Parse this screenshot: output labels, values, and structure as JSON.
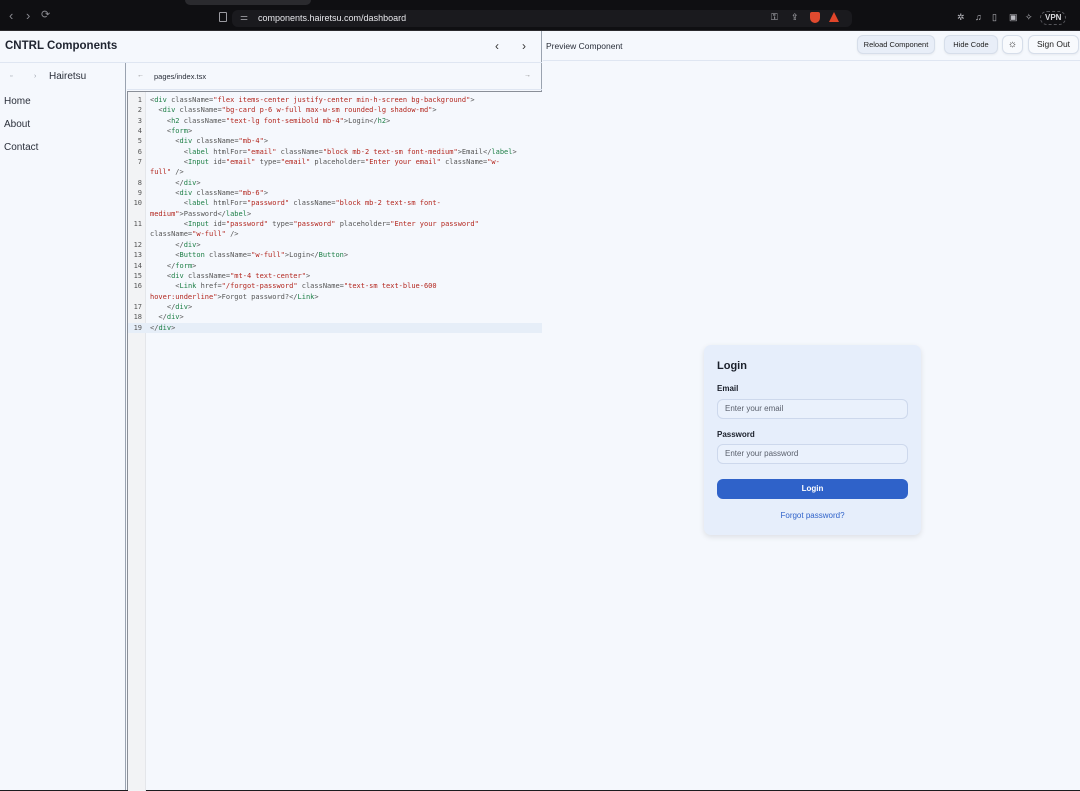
{
  "browser": {
    "url": "components.hairetsu.com/dashboard",
    "vpn_label": "VPN",
    "nav": {
      "back": "‹",
      "forward": "›",
      "reload": "⟳"
    }
  },
  "app": {
    "title": "CNTRL Components",
    "header_prev": "‹",
    "header_next": "›"
  },
  "sidebar": {
    "brand": "Hairetsu",
    "items": [
      {
        "label": "Home"
      },
      {
        "label": "About"
      },
      {
        "label": "Contact"
      }
    ]
  },
  "editor": {
    "file_name": "pages/index.tsx",
    "lines": [
      {
        "n": "1",
        "segs": [
          [
            "pu",
            "<"
          ],
          [
            "tg",
            "div"
          ],
          [
            "pu",
            " className="
          ],
          [
            "st",
            "\"flex items-center justify-center min-h-screen bg-background\""
          ],
          [
            "pu",
            ">"
          ]
        ]
      },
      {
        "n": "2",
        "segs": [
          [
            "pu",
            "  <"
          ],
          [
            "tg",
            "div"
          ],
          [
            "pu",
            " className="
          ],
          [
            "st",
            "\"bg-card p-6 w-full max-w-sm rounded-lg shadow-md\""
          ],
          [
            "pu",
            ">"
          ]
        ]
      },
      {
        "n": "3",
        "segs": [
          [
            "pu",
            "    <"
          ],
          [
            "tg",
            "h2"
          ],
          [
            "pu",
            " className="
          ],
          [
            "st",
            "\"text-lg font-semibold mb-4\""
          ],
          [
            "pu",
            ">Login</"
          ],
          [
            "tg",
            "h2"
          ],
          [
            "pu",
            ">"
          ]
        ]
      },
      {
        "n": "4",
        "segs": [
          [
            "pu",
            "    <"
          ],
          [
            "tg",
            "form"
          ],
          [
            "pu",
            ">"
          ]
        ]
      },
      {
        "n": "5",
        "segs": [
          [
            "pu",
            "      <"
          ],
          [
            "tg",
            "div"
          ],
          [
            "pu",
            " className="
          ],
          [
            "st",
            "\"mb-4\""
          ],
          [
            "pu",
            ">"
          ]
        ]
      },
      {
        "n": "6",
        "segs": [
          [
            "pu",
            "        <"
          ],
          [
            "tg",
            "label"
          ],
          [
            "pu",
            " htmlFor="
          ],
          [
            "st",
            "\"email\""
          ],
          [
            "pu",
            " className="
          ],
          [
            "st",
            "\"block mb-2 text-sm font-medium\""
          ],
          [
            "pu",
            ">Email</"
          ],
          [
            "tg",
            "label"
          ],
          [
            "pu",
            ">"
          ]
        ]
      },
      {
        "n": "7",
        "segs": [
          [
            "pu",
            "        <"
          ],
          [
            "tg",
            "Input"
          ],
          [
            "pu",
            " id="
          ],
          [
            "st",
            "\"email\""
          ],
          [
            "pu",
            " type="
          ],
          [
            "st",
            "\"email\""
          ],
          [
            "pu",
            " placeholder="
          ],
          [
            "st",
            "\"Enter your email\""
          ],
          [
            "pu",
            " className="
          ],
          [
            "st",
            "\"w-"
          ]
        ]
      },
      {
        "n": "",
        "segs": [
          [
            "st",
            "full\""
          ],
          [
            "pu",
            " />"
          ]
        ]
      },
      {
        "n": "8",
        "segs": [
          [
            "pu",
            "      </"
          ],
          [
            "tg",
            "div"
          ],
          [
            "pu",
            ">"
          ]
        ]
      },
      {
        "n": "9",
        "segs": [
          [
            "pu",
            "      <"
          ],
          [
            "tg",
            "div"
          ],
          [
            "pu",
            " className="
          ],
          [
            "st",
            "\"mb-6\""
          ],
          [
            "pu",
            ">"
          ]
        ]
      },
      {
        "n": "10",
        "segs": [
          [
            "pu",
            "        <"
          ],
          [
            "tg",
            "label"
          ],
          [
            "pu",
            " htmlFor="
          ],
          [
            "st",
            "\"password\""
          ],
          [
            "pu",
            " className="
          ],
          [
            "st",
            "\"block mb-2 text-sm font-"
          ]
        ]
      },
      {
        "n": "",
        "segs": [
          [
            "st",
            "medium\""
          ],
          [
            "pu",
            ">Password</"
          ],
          [
            "tg",
            "label"
          ],
          [
            "pu",
            ">"
          ]
        ]
      },
      {
        "n": "11",
        "segs": [
          [
            "pu",
            "        <"
          ],
          [
            "tg",
            "Input"
          ],
          [
            "pu",
            " id="
          ],
          [
            "st",
            "\"password\""
          ],
          [
            "pu",
            " type="
          ],
          [
            "st",
            "\"password\""
          ],
          [
            "pu",
            " placeholder="
          ],
          [
            "st",
            "\"Enter your password\""
          ]
        ]
      },
      {
        "n": "",
        "segs": [
          [
            "pu",
            "className="
          ],
          [
            "st",
            "\"w-full\""
          ],
          [
            "pu",
            " />"
          ]
        ]
      },
      {
        "n": "12",
        "segs": [
          [
            "pu",
            "      </"
          ],
          [
            "tg",
            "div"
          ],
          [
            "pu",
            ">"
          ]
        ]
      },
      {
        "n": "13",
        "segs": [
          [
            "pu",
            "      <"
          ],
          [
            "tg",
            "Button"
          ],
          [
            "pu",
            " className="
          ],
          [
            "st",
            "\"w-full\""
          ],
          [
            "pu",
            ">Login</"
          ],
          [
            "tg",
            "Button"
          ],
          [
            "pu",
            ">"
          ]
        ]
      },
      {
        "n": "14",
        "segs": [
          [
            "pu",
            "    </"
          ],
          [
            "tg",
            "form"
          ],
          [
            "pu",
            ">"
          ]
        ]
      },
      {
        "n": "15",
        "segs": [
          [
            "pu",
            "    <"
          ],
          [
            "tg",
            "div"
          ],
          [
            "pu",
            " className="
          ],
          [
            "st",
            "\"mt-4 text-center\""
          ],
          [
            "pu",
            ">"
          ]
        ]
      },
      {
        "n": "16",
        "segs": [
          [
            "pu",
            "      <"
          ],
          [
            "tg",
            "Link"
          ],
          [
            "pu",
            " href="
          ],
          [
            "st",
            "\"/forgot-password\""
          ],
          [
            "pu",
            " className="
          ],
          [
            "st",
            "\"text-sm text-blue-600"
          ]
        ]
      },
      {
        "n": "",
        "segs": [
          [
            "st",
            "hover:underline\""
          ],
          [
            "pu",
            ">Forgot password?</"
          ],
          [
            "tg",
            "Link"
          ],
          [
            "pu",
            ">"
          ]
        ]
      },
      {
        "n": "17",
        "segs": [
          [
            "pu",
            "    </"
          ],
          [
            "tg",
            "div"
          ],
          [
            "pu",
            ">"
          ]
        ]
      },
      {
        "n": "18",
        "segs": [
          [
            "pu",
            "  </"
          ],
          [
            "tg",
            "div"
          ],
          [
            "pu",
            ">"
          ]
        ]
      },
      {
        "n": "19",
        "segs": [
          [
            "pu",
            "</"
          ],
          [
            "tg",
            "div"
          ],
          [
            "pu",
            ">"
          ]
        ],
        "active": true
      }
    ]
  },
  "preview": {
    "title": "Preview Component",
    "reload_label": "Reload Component",
    "hide_code_label": "Hide Code",
    "theme_icon": "☼",
    "sign_out_label": "Sign Out",
    "card": {
      "title": "Login",
      "email_label": "Email",
      "email_placeholder": "Enter your email",
      "password_label": "Password",
      "password_placeholder": "Enter your password",
      "login_button": "Login",
      "forgot_link": "Forgot password?"
    }
  },
  "colors": {
    "accent": "#2f62c9",
    "tag": "#1d7f46",
    "string": "#b3261e",
    "card_bg": "#e6eefb"
  }
}
